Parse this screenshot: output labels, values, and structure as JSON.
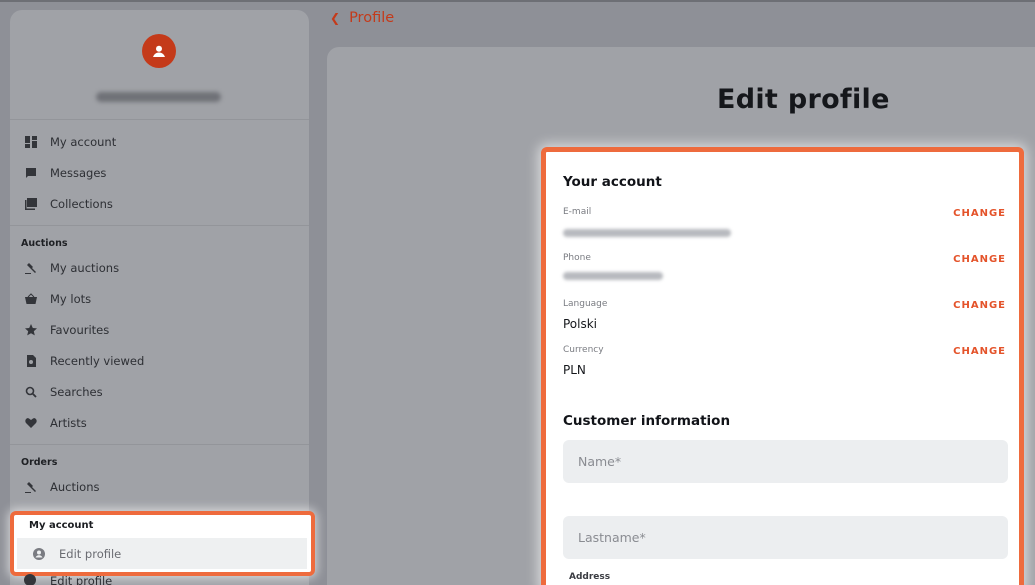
{
  "breadcrumb": {
    "label": "Profile"
  },
  "page": {
    "title": "Edit profile"
  },
  "sidebar": {
    "main_items": [
      {
        "label": "My account",
        "icon": "dashboard-icon"
      },
      {
        "label": "Messages",
        "icon": "chat-icon"
      },
      {
        "label": "Collections",
        "icon": "library-icon"
      }
    ],
    "auctions_title": "Auctions",
    "auction_items": [
      {
        "label": "My auctions",
        "icon": "gavel-icon"
      },
      {
        "label": "My lots",
        "icon": "basket-icon"
      },
      {
        "label": "Favourites",
        "icon": "star-icon"
      },
      {
        "label": "Recently viewed",
        "icon": "history-icon"
      },
      {
        "label": "Searches",
        "icon": "search-icon"
      },
      {
        "label": "Artists",
        "icon": "heart-icon"
      }
    ],
    "orders_title": "Orders",
    "order_items": [
      {
        "label": "Auctions",
        "icon": "gavel-icon"
      }
    ],
    "account_title": "My account",
    "account_items": [
      {
        "label": "Edit profile",
        "icon": "user-circle-icon"
      }
    ],
    "below_item": "Edit profile"
  },
  "account": {
    "title": "Your account",
    "change_label": "CHANGE",
    "email_label": "E-mail",
    "phone_label": "Phone",
    "language_label": "Language",
    "language_value": "Polski",
    "currency_label": "Currency",
    "currency_value": "PLN"
  },
  "customer": {
    "title": "Customer information",
    "name_placeholder": "Name*",
    "lastname_placeholder": "Lastname*",
    "address_label": "Address"
  },
  "colors": {
    "accent": "#e4532a",
    "highlight": "#ee6b3d",
    "avatar": "#c43a1a"
  }
}
